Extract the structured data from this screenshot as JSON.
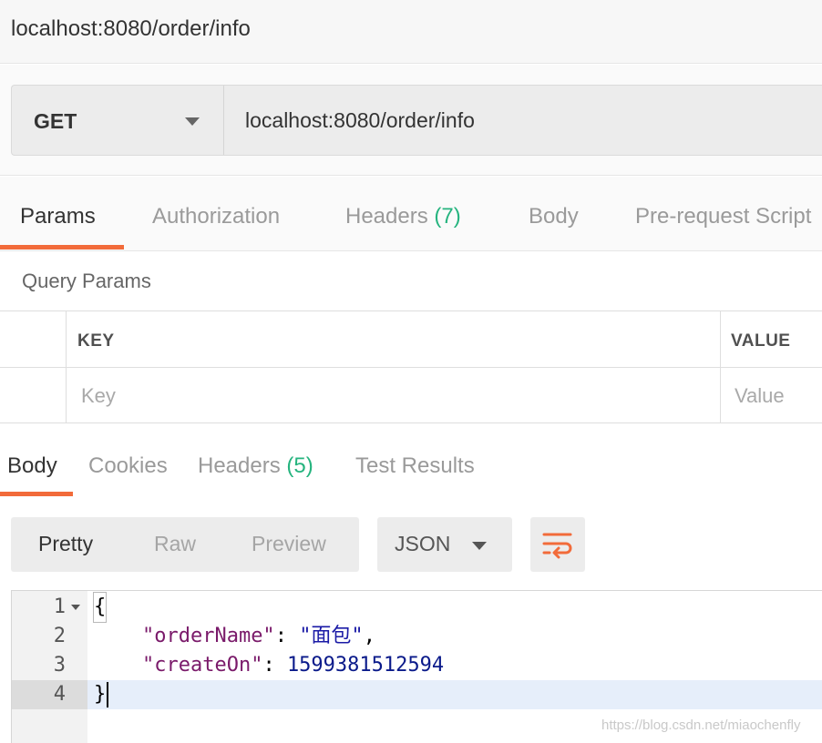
{
  "window": {
    "title": "localhost:8080/order/info"
  },
  "request": {
    "method": "GET",
    "url": "localhost:8080/order/info"
  },
  "request_tabs": {
    "params": "Params",
    "authorization": "Authorization",
    "headers": "Headers",
    "headers_count": "(7)",
    "body": "Body",
    "prerequest": "Pre-request Script",
    "active": "Params"
  },
  "query_params": {
    "label": "Query Params",
    "key_header": "KEY",
    "value_header": "VALUE",
    "key_placeholder": "Key",
    "value_placeholder": "Value"
  },
  "response_tabs": {
    "body": "Body",
    "cookies": "Cookies",
    "headers": "Headers",
    "headers_count": "(5)",
    "test_results": "Test Results",
    "active": "Body"
  },
  "response_toolbar": {
    "pretty": "Pretty",
    "raw": "Raw",
    "preview": "Preview",
    "active_view": "Pretty",
    "format": "JSON",
    "wrap_icon": "wrap-lines-icon"
  },
  "response_body": {
    "line_numbers": [
      "1",
      "2",
      "3",
      "4"
    ],
    "line1": "{",
    "line2_key": "\"orderName\"",
    "line2_value": "\"面包\"",
    "line3_key": "\"createOn\"",
    "line3_value": "1599381512594",
    "line4": "}"
  },
  "watermark": "https://blog.csdn.net/miaochenfly",
  "colors": {
    "accent": "#f26b3a",
    "count_green": "#26b47f",
    "json_key": "#7a1a6a",
    "json_string": "#1a1aa6",
    "json_number": "#0a1a8a"
  }
}
